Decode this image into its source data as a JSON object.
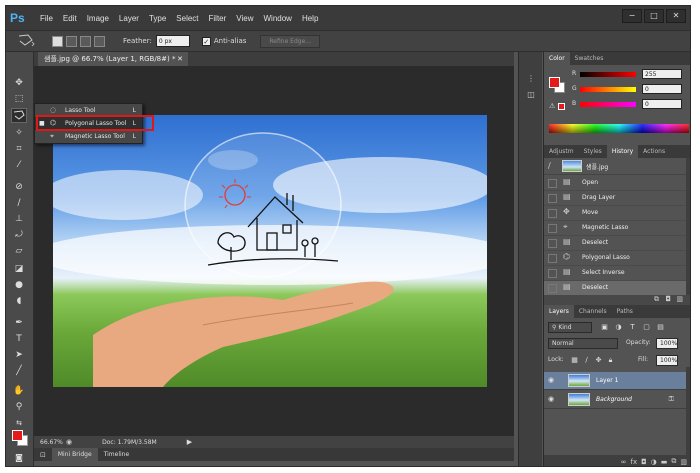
{
  "app": {
    "logo": "Ps"
  },
  "menu": [
    "File",
    "Edit",
    "Image",
    "Layer",
    "Type",
    "Select",
    "Filter",
    "View",
    "Window",
    "Help"
  ],
  "window_buttons": [
    "−",
    "□",
    "✕"
  ],
  "options": {
    "feather_label": "Feather:",
    "feather_value": "0 px",
    "antialias_label": "Anti-alias",
    "refine_edge": "Refine Edge..."
  },
  "document": {
    "tab_title": "샘플.jpg @ 66.7% (Layer 1, RGB/8#) *",
    "zoom": "66.67%",
    "doc_info": "Doc: 1.79M/3.58M"
  },
  "bridge_tabs": [
    "Mini Bridge",
    "Timeline"
  ],
  "flyout": {
    "items": [
      {
        "label": "Lasso Tool",
        "key": "L",
        "icon": "lasso-icon"
      },
      {
        "label": "Polygonal Lasso Tool",
        "key": "L",
        "icon": "polygonal-lasso-icon",
        "current": true
      },
      {
        "label": "Magnetic Lasso Tool",
        "key": "L",
        "icon": "magnetic-lasso-icon"
      }
    ]
  },
  "color_panel": {
    "tabs": [
      "Color",
      "Swatches"
    ],
    "channels": [
      {
        "name": "R",
        "value": "255"
      },
      {
        "name": "G",
        "value": "0"
      },
      {
        "name": "B",
        "value": "0"
      }
    ],
    "fg_color": "#e51a1a"
  },
  "history_panel": {
    "tabs": [
      "Adjustm",
      "Styles",
      "History",
      "Actions"
    ],
    "snapshot": "샘플.jpg",
    "items": [
      "Open",
      "Drag Layer",
      "Move",
      "Magnetic Lasso",
      "Deselect",
      "Polygonal Lasso",
      "Select Inverse",
      "Deselect"
    ]
  },
  "layers_panel": {
    "tabs": [
      "Layers",
      "Channels",
      "Paths"
    ],
    "kind": "Kind",
    "blend_mode": "Normal",
    "opacity_label": "Opacity:",
    "opacity_value": "100%",
    "lock_label": "Lock:",
    "fill_label": "Fill:",
    "fill_value": "100%",
    "layers": [
      {
        "name": "Layer 1",
        "selected": true
      },
      {
        "name": "Background",
        "locked": true
      }
    ]
  }
}
